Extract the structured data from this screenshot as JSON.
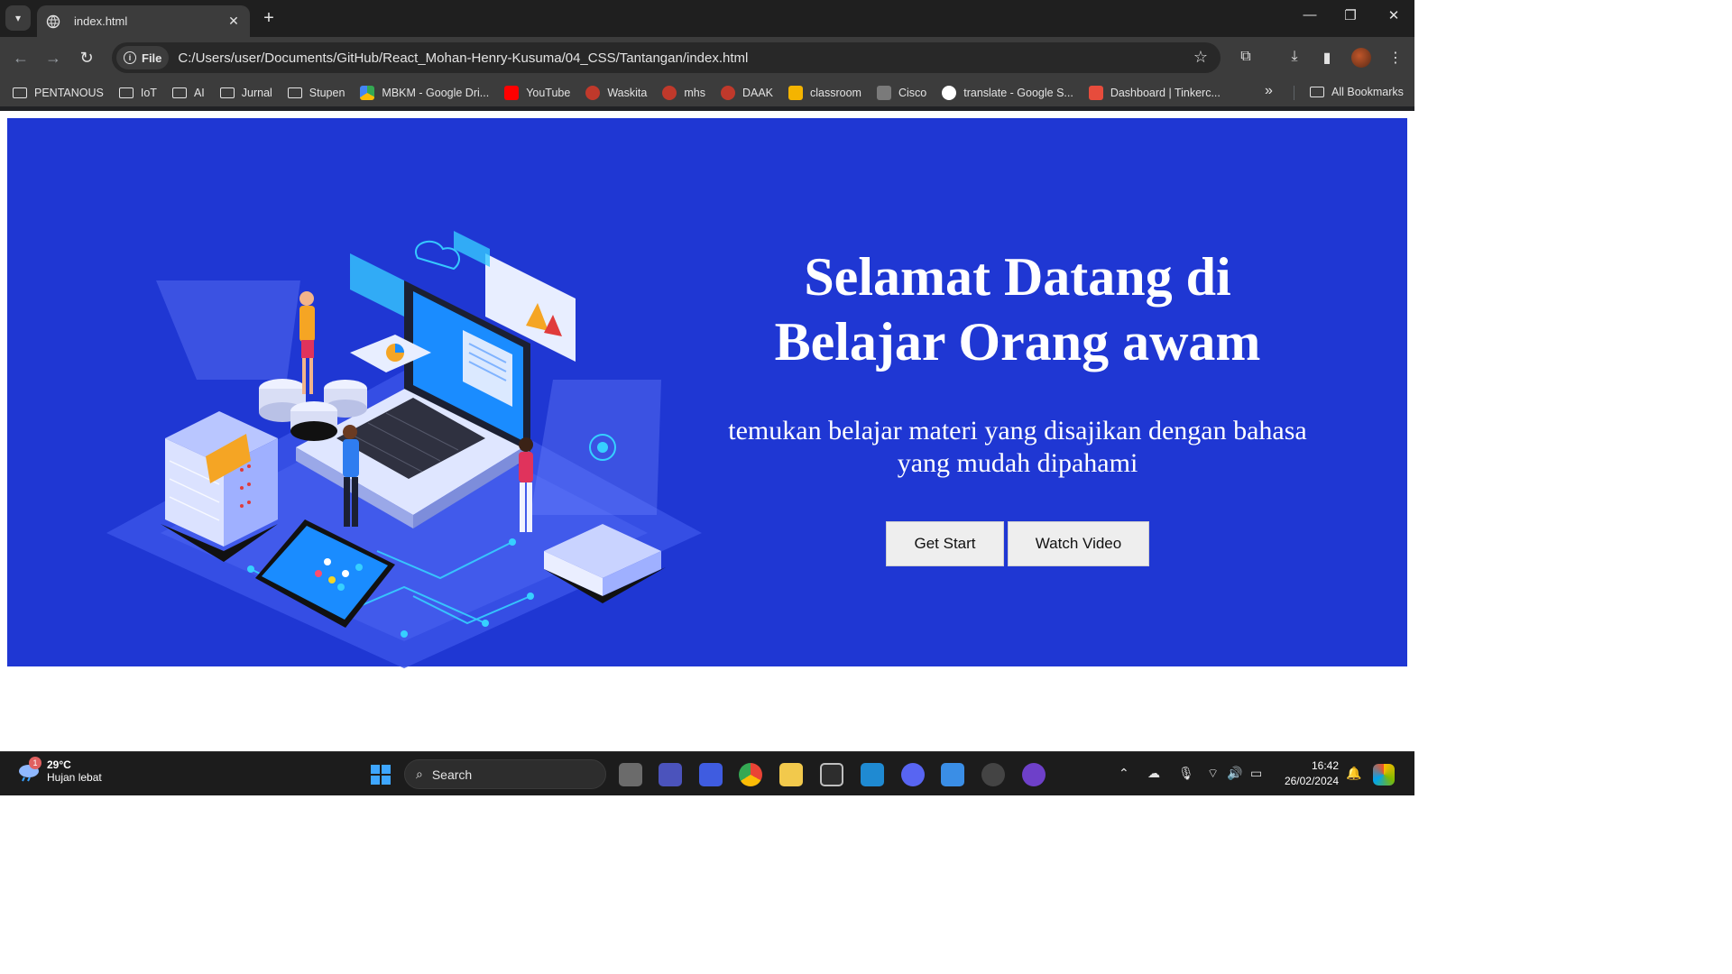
{
  "browser": {
    "tab_title": "index.html",
    "url_chip": "File",
    "url": "C:/Users/user/Documents/GitHub/React_Mohan-Henry-Kusuma/04_CSS/Tantangan/index.html",
    "bookmarks": [
      {
        "label": "PENTANOUS",
        "icon": "folder-icon"
      },
      {
        "label": "IoT",
        "icon": "folder-icon"
      },
      {
        "label": "AI",
        "icon": "folder-icon"
      },
      {
        "label": "Jurnal",
        "icon": "folder-icon"
      },
      {
        "label": "Stupen",
        "icon": "folder-icon"
      },
      {
        "label": "MBKM - Google Dri...",
        "icon": "google-drive-icon"
      },
      {
        "label": "YouTube",
        "icon": "youtube-icon"
      },
      {
        "label": "Waskita",
        "icon": "site-icon"
      },
      {
        "label": "mhs",
        "icon": "site-icon"
      },
      {
        "label": "DAAK",
        "icon": "site-icon"
      },
      {
        "label": "classroom",
        "icon": "classroom-icon"
      },
      {
        "label": "Cisco",
        "icon": "cisco-icon"
      },
      {
        "label": "translate - Google S...",
        "icon": "google-icon"
      },
      {
        "label": "Dashboard | Tinkerc...",
        "icon": "tinkercad-icon"
      }
    ],
    "all_bookmarks": "All Bookmarks"
  },
  "hero": {
    "title_line1": "Selamat Datang di",
    "title_line2": "Belajar Orang awam",
    "subtitle_line1": "temukan belajar materi yang disajikan dengan bahasa",
    "subtitle_line2": "yang mudah dipahami",
    "btn_get_start": "Get Start",
    "btn_watch_video": "Watch Video",
    "background": "#1f37d3"
  },
  "taskbar": {
    "temperature": "29°C",
    "weather": "Hujan lebat",
    "weather_badge": "1",
    "search_label": "Search",
    "time": "16:42",
    "date": "26/02/2024"
  }
}
